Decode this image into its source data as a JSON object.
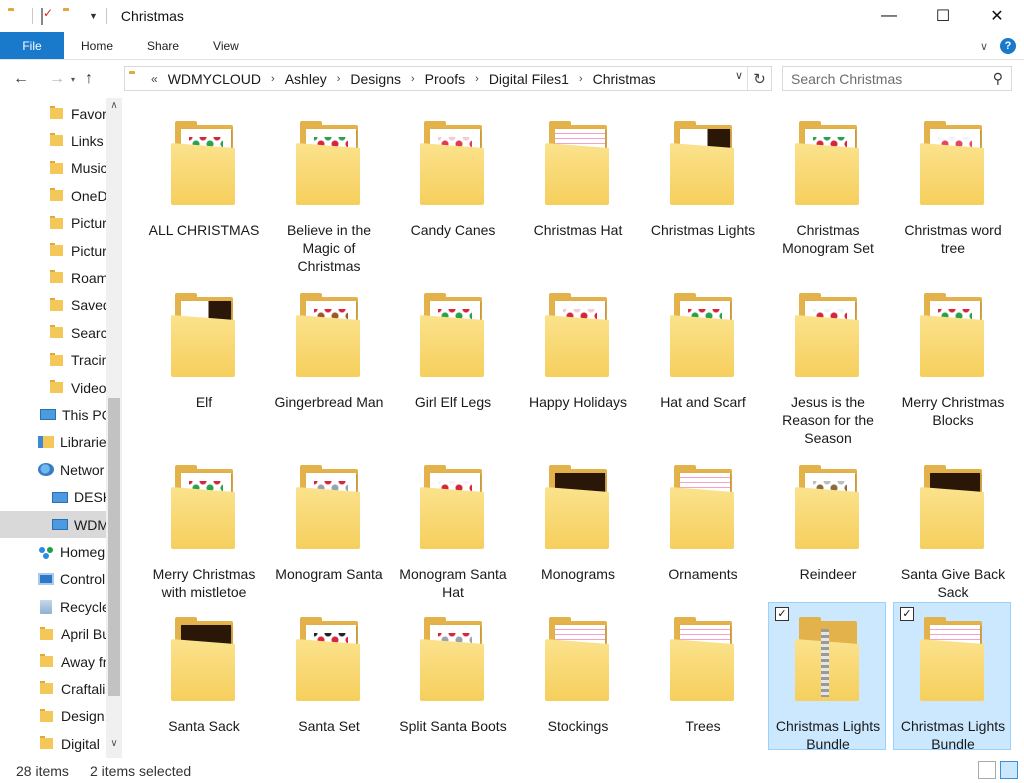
{
  "window": {
    "title": "Christmas",
    "minimize_glyph": "—",
    "maximize_glyph": "☐",
    "close_glyph": "✕"
  },
  "ribbon": {
    "tabs": [
      "File",
      "Home",
      "Share",
      "View"
    ],
    "help_glyph": "?"
  },
  "nav": {
    "back_glyph": "←",
    "forward_glyph": "→",
    "up_glyph": "↑",
    "breadcrumb": [
      "WDMYCLOUD",
      "Ashley",
      "Designs",
      "Proofs",
      "Digital Files1",
      "Christmas"
    ],
    "overflow_glyph": "«",
    "refresh_glyph": "↻",
    "search_placeholder": "Search Christmas"
  },
  "sidebar": {
    "items": [
      {
        "label": "Favori",
        "icon": "folder-icon"
      },
      {
        "label": "Links",
        "icon": "folder-icon"
      },
      {
        "label": "Music",
        "icon": "folder-icon"
      },
      {
        "label": "OneD",
        "icon": "folder-icon"
      },
      {
        "label": "Pictur",
        "icon": "folder-icon"
      },
      {
        "label": "Pictur",
        "icon": "folder-icon"
      },
      {
        "label": "Roam",
        "icon": "folder-icon"
      },
      {
        "label": "Saved",
        "icon": "folder-icon"
      },
      {
        "label": "Searcl",
        "icon": "folder-icon"
      },
      {
        "label": "Tracin",
        "icon": "folder-icon"
      },
      {
        "label": "Video",
        "icon": "folder-icon"
      },
      {
        "label": "This PC",
        "icon": "pc-icon"
      },
      {
        "label": "Librarie",
        "icon": "libraries-icon"
      },
      {
        "label": "Networ",
        "icon": "network-icon"
      },
      {
        "label": "DESKT",
        "icon": "pc-icon"
      },
      {
        "label": "WDM",
        "icon": "pc-icon",
        "selected": true
      },
      {
        "label": "Homeg",
        "icon": "homegroup-icon"
      },
      {
        "label": "Control",
        "icon": "control-panel-icon"
      },
      {
        "label": "Recycle",
        "icon": "recycle-bin-icon"
      },
      {
        "label": "April Bu",
        "icon": "folder-icon"
      },
      {
        "label": "Away fr",
        "icon": "folder-icon"
      },
      {
        "label": "Craftali",
        "icon": "folder-icon"
      },
      {
        "label": "Design:",
        "icon": "folder-icon"
      },
      {
        "label": "Digital",
        "icon": "folder-icon"
      }
    ]
  },
  "folders": [
    {
      "label": "ALL CHRISTMAS",
      "preview": "dots",
      "c1": "#2aa14b",
      "c2": "#d6263b"
    },
    {
      "label": "Believe in the Magic of Christmas",
      "preview": "dots",
      "c1": "#d6263b",
      "c2": "#2aa14b"
    },
    {
      "label": "Candy Canes",
      "preview": "dots",
      "c1": "#e23a4e",
      "c2": "#f7c9d0"
    },
    {
      "label": "Christmas Hat",
      "preview": "lines"
    },
    {
      "label": "Christmas Lights",
      "preview": "dark"
    },
    {
      "label": "Christmas Monogram Set",
      "preview": "dots",
      "c1": "#d6263b",
      "c2": "#2aa14b"
    },
    {
      "label": "Christmas word tree",
      "preview": "dots",
      "c1": "#e4475c",
      "c2": "#f3f3f3"
    },
    {
      "label": "Elf",
      "preview": "dark"
    },
    {
      "label": "Gingerbread Man",
      "preview": "dots",
      "c1": "#9a5b2c",
      "c2": "#d6263b"
    },
    {
      "label": "Girl Elf Legs",
      "preview": "dots",
      "c1": "#2aa14b",
      "c2": "#d6263b"
    },
    {
      "label": "Happy Holidays",
      "preview": "dots",
      "c1": "#d6263b",
      "c2": "#f7c9d0"
    },
    {
      "label": "Hat and Scarf",
      "preview": "dots",
      "c1": "#2aa14b",
      "c2": "#d6263b"
    },
    {
      "label": "Jesus is the Reason for the Season",
      "preview": "dots",
      "c1": "#d6263b",
      "c2": "#f3f3f3"
    },
    {
      "label": "Merry Christmas Blocks",
      "preview": "dots",
      "c1": "#2aa14b",
      "c2": "#d6263b"
    },
    {
      "label": "Merry Christmas with mistletoe",
      "preview": "dots",
      "c1": "#2aa14b",
      "c2": "#d6263b"
    },
    {
      "label": "Monogram Santa",
      "preview": "dots",
      "c1": "#9aa3ad",
      "c2": "#d6263b"
    },
    {
      "label": "Monogram Santa Hat",
      "preview": "dots",
      "c1": "#d6263b",
      "c2": "#f3f3f3"
    },
    {
      "label": "Monograms",
      "preview": "ai"
    },
    {
      "label": "Ornaments",
      "preview": "lines"
    },
    {
      "label": "Reindeer",
      "preview": "dots",
      "c1": "#8a6b3e",
      "c2": "#bdbdbd"
    },
    {
      "label": "Santa Give Back Sack",
      "preview": "ai"
    },
    {
      "label": "Santa Sack",
      "preview": "ai"
    },
    {
      "label": "Santa Set",
      "preview": "dots",
      "c1": "#d6263b",
      "c2": "#222"
    },
    {
      "label": "Split Santa Boots",
      "preview": "dots",
      "c1": "#9aa3ad",
      "c2": "#d6263b"
    },
    {
      "label": "Stockings",
      "preview": "lines"
    },
    {
      "label": "Trees",
      "preview": "lines"
    },
    {
      "label": "Christmas Lights Bundle",
      "preview": "zip",
      "selected": true
    },
    {
      "label": "Christmas Lights Bundle",
      "preview": "lines",
      "selected": true
    }
  ],
  "status": {
    "item_count": "28 items",
    "selected_count": "2 items selected"
  },
  "colors": {
    "accent": "#1979ca",
    "selection_bg": "#cce8ff",
    "selection_border": "#99d1ff",
    "folder_yellow": "#f6cf5d"
  }
}
